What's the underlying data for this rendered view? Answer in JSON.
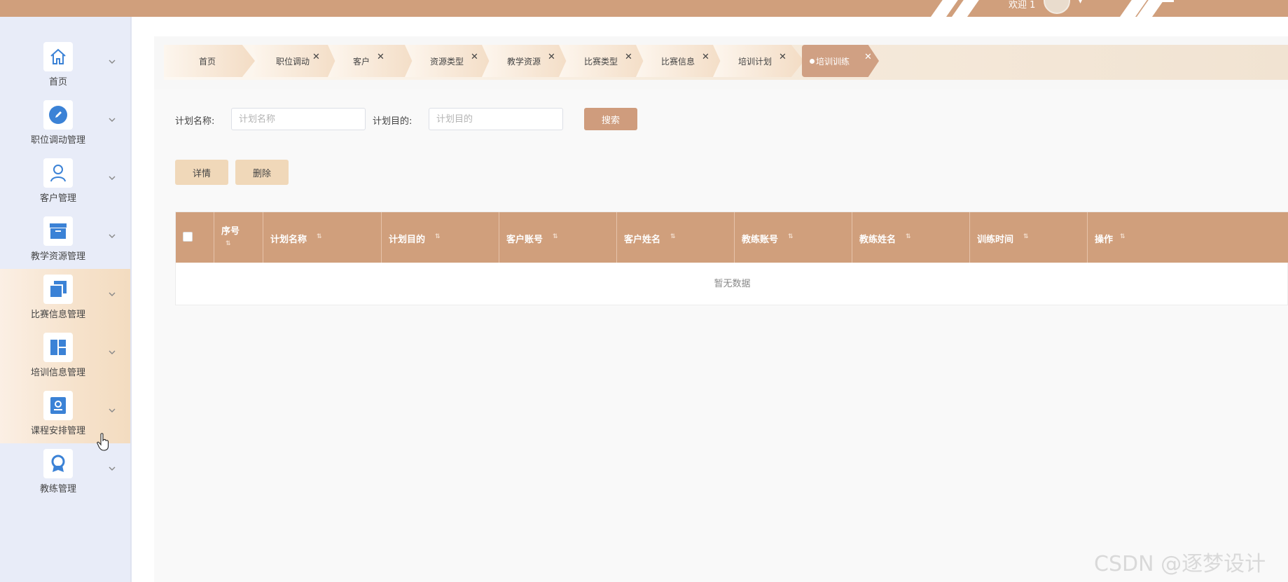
{
  "topbar": {
    "welcome": "欢迎 1"
  },
  "sidebar": {
    "items": [
      {
        "label": "首页",
        "icon": "home-icon",
        "active": false
      },
      {
        "label": "职位调动管理",
        "icon": "edit-icon",
        "active": false
      },
      {
        "label": "客户管理",
        "icon": "user-icon",
        "active": false
      },
      {
        "label": "教学资源管理",
        "icon": "archive-icon",
        "active": false
      },
      {
        "label": "比赛信息管理",
        "icon": "copy-icon",
        "active": true
      },
      {
        "label": "培训信息管理",
        "icon": "layout-icon",
        "active": true
      },
      {
        "label": "课程安排管理",
        "icon": "id-card-icon",
        "active": true
      },
      {
        "label": "教练管理",
        "icon": "badge-icon",
        "active": false
      }
    ]
  },
  "tabs": [
    {
      "label": "首页",
      "closable": false
    },
    {
      "label": "职位调动",
      "closable": true
    },
    {
      "label": "客户",
      "closable": true
    },
    {
      "label": "资源类型",
      "closable": true
    },
    {
      "label": "教学资源",
      "closable": true
    },
    {
      "label": "比赛类型",
      "closable": true
    },
    {
      "label": "比赛信息",
      "closable": true
    },
    {
      "label": "培训计划",
      "closable": true
    },
    {
      "label": "培训训练",
      "closable": true,
      "active": true
    }
  ],
  "search": {
    "plan_name_label": "计划名称:",
    "plan_name_placeholder": "计划名称",
    "plan_goal_label": "计划目的:",
    "plan_goal_placeholder": "计划目的",
    "search_button": "搜索"
  },
  "actions": {
    "details": "详情",
    "delete": "删除"
  },
  "table": {
    "columns": [
      "序号",
      "计划名称",
      "计划目的",
      "客户账号",
      "客户姓名",
      "教练账号",
      "教练姓名",
      "训练时间",
      "操作"
    ],
    "empty_text": "暂无数据"
  },
  "watermark": "CSDN @逐梦设计",
  "colors": {
    "accent": "#d09f7c",
    "sidebar_bg": "#e8ecf8",
    "icon_blue": "#3b82d6",
    "action_button": "#f0d8b9"
  }
}
